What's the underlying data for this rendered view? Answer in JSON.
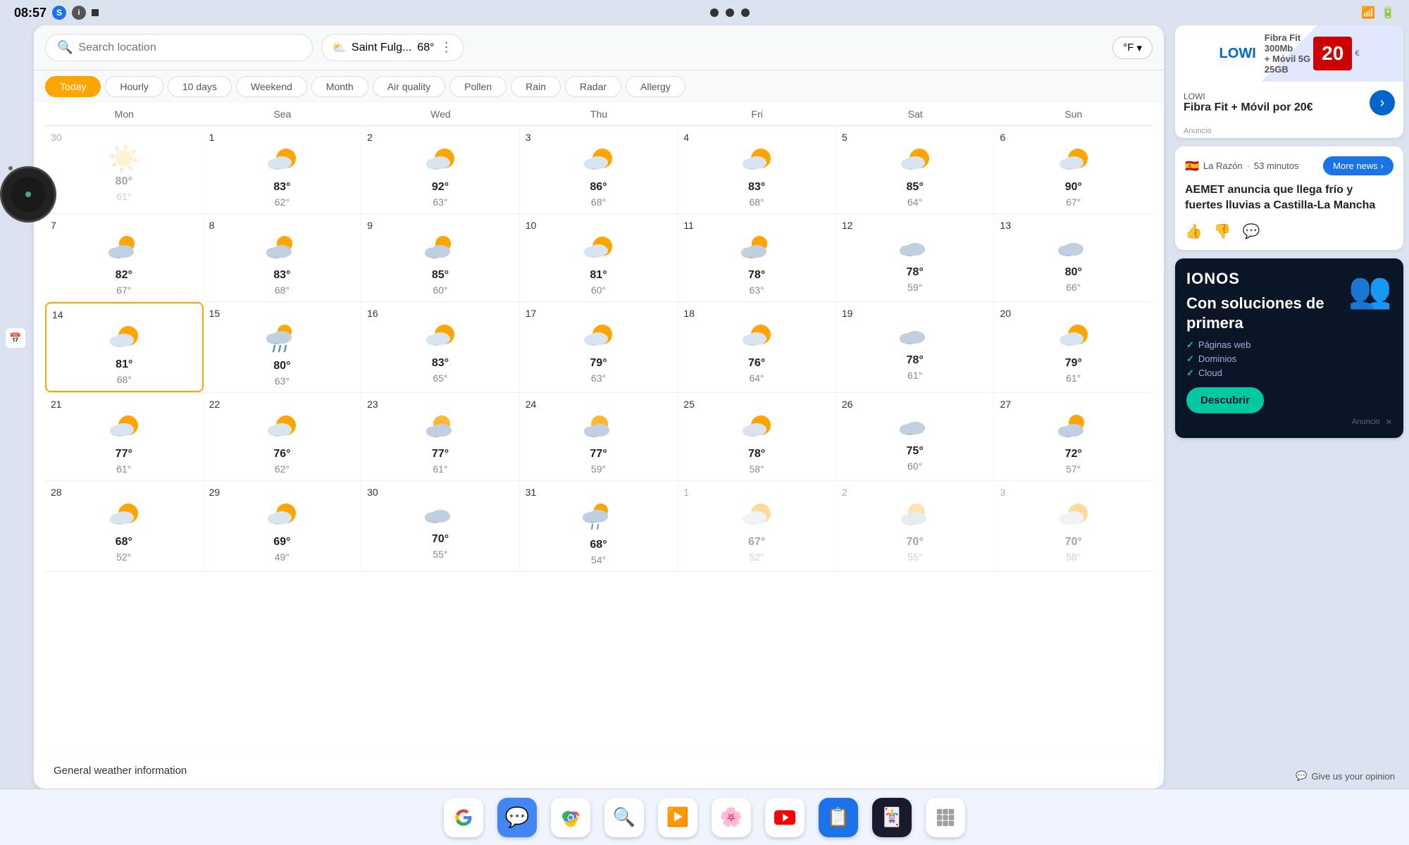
{
  "statusBar": {
    "time": "08:57",
    "icons": [
      "S",
      "info",
      "dot"
    ],
    "rightIcons": [
      "wifi",
      "battery"
    ]
  },
  "searchBar": {
    "placeholder": "Search location",
    "location": "Saint Fulg...",
    "temp": "68°",
    "unit": "°F"
  },
  "tabs": [
    {
      "label": "Today",
      "active": true
    },
    {
      "label": "Hourly"
    },
    {
      "label": "10 days"
    },
    {
      "label": "Weekend"
    },
    {
      "label": "Month"
    },
    {
      "label": "Air quality"
    },
    {
      "label": "Pollen"
    },
    {
      "label": "Rain"
    },
    {
      "label": "Radar"
    },
    {
      "label": "Allergy"
    }
  ],
  "weekDays": [
    "Mon",
    "Sea",
    "Wed",
    "Thu",
    "Fri",
    "Sat",
    "Sun"
  ],
  "calendar": {
    "weeks": [
      {
        "days": [
          {
            "num": "30",
            "icon": "sun-pale",
            "high": "80°",
            "low": "61°",
            "dimmed": true
          },
          {
            "num": "1",
            "icon": "partly-sunny",
            "high": "83°",
            "low": "62°"
          },
          {
            "num": "2",
            "icon": "partly-sunny",
            "high": "92°",
            "low": "63°"
          },
          {
            "num": "3",
            "icon": "partly-sunny",
            "high": "86°",
            "low": "68°"
          },
          {
            "num": "4",
            "icon": "partly-sunny",
            "high": "83°",
            "low": "68°"
          },
          {
            "num": "5",
            "icon": "partly-sunny",
            "high": "85°",
            "low": "64°"
          },
          {
            "num": "6",
            "icon": "partly-sunny",
            "high": "90°",
            "low": "67°"
          }
        ]
      },
      {
        "days": [
          {
            "num": "7",
            "icon": "cloudy-sun",
            "high": "82°",
            "low": "67°"
          },
          {
            "num": "8",
            "icon": "cloudy-sun",
            "high": "83°",
            "low": "68°"
          },
          {
            "num": "9",
            "icon": "cloudy-sun",
            "high": "85°",
            "low": "60°"
          },
          {
            "num": "10",
            "icon": "partly-sunny",
            "high": "81°",
            "low": "60°"
          },
          {
            "num": "11",
            "icon": "cloudy-sun",
            "high": "78°",
            "low": "63°"
          },
          {
            "num": "12",
            "icon": "cloudy",
            "high": "78°",
            "low": "59°"
          },
          {
            "num": "13",
            "icon": "cloudy",
            "high": "80°",
            "low": "66°"
          }
        ]
      },
      {
        "days": [
          {
            "num": "14",
            "icon": "partly-sunny",
            "high": "81°",
            "low": "68°",
            "highlighted": true
          },
          {
            "num": "15",
            "icon": "rainy",
            "high": "80°",
            "low": "63°"
          },
          {
            "num": "16",
            "icon": "partly-sunny",
            "high": "83°",
            "low": "65°"
          },
          {
            "num": "17",
            "icon": "partly-sunny",
            "high": "79°",
            "low": "63°"
          },
          {
            "num": "18",
            "icon": "partly-sunny",
            "high": "76°",
            "low": "64°"
          },
          {
            "num": "19",
            "icon": "cloudy",
            "high": "78°",
            "low": "61°"
          },
          {
            "num": "20",
            "icon": "partly-sunny",
            "high": "79°",
            "low": "61°"
          }
        ]
      },
      {
        "days": [
          {
            "num": "21",
            "icon": "partly-sunny",
            "high": "77°",
            "low": "61°"
          },
          {
            "num": "22",
            "icon": "partly-sunny",
            "high": "76°",
            "low": "62°"
          },
          {
            "num": "23",
            "icon": "partly-cloudy",
            "high": "77°",
            "low": "61°"
          },
          {
            "num": "24",
            "icon": "partly-cloudy",
            "high": "77°",
            "low": "59°"
          },
          {
            "num": "25",
            "icon": "partly-sunny",
            "high": "78°",
            "low": "58°"
          },
          {
            "num": "26",
            "icon": "cloudy",
            "high": "75°",
            "low": "60°"
          },
          {
            "num": "27",
            "icon": "cloudy-sun",
            "high": "72°",
            "low": "57°"
          }
        ]
      },
      {
        "days": [
          {
            "num": "28",
            "icon": "partly-sunny",
            "high": "68°",
            "low": "52°"
          },
          {
            "num": "29",
            "icon": "partly-sunny",
            "high": "69°",
            "low": "49°"
          },
          {
            "num": "30",
            "icon": "cloudy",
            "high": "70°",
            "low": "55°"
          },
          {
            "num": "31",
            "icon": "drizzle",
            "high": "68°",
            "low": "54°"
          },
          {
            "num": "1",
            "icon": "partly-sunny",
            "high": "67°",
            "low": "52°",
            "dimmed": true
          },
          {
            "num": "2",
            "icon": "partly-cloudy",
            "high": "70°",
            "low": "55°",
            "dimmed": true
          },
          {
            "num": "3",
            "icon": "partly-sunny",
            "high": "70°",
            "low": "58°",
            "dimmed": true
          }
        ]
      }
    ]
  },
  "generalInfo": {
    "label": "General weather information"
  },
  "ad1": {
    "brand": "LOWI",
    "headline": "Fibra Fit + Móvil por 20€",
    "badge": "20",
    "label": "Anuncio"
  },
  "news": {
    "source": "La Razón",
    "time": "53 minutos",
    "moreNewsLabel": "More news",
    "headline": "AEMET anuncia que llega frío y fuertes lluvias a Castilla-La Mancha"
  },
  "ad2": {
    "brand": "IONOS",
    "headline": "Con soluciones de primera",
    "checks": [
      "Páginas web",
      "Dominios",
      "Cloud"
    ],
    "cta": "Descubrir",
    "label": "Anuncio"
  },
  "opinion": {
    "label": "Give us your opinion"
  },
  "taskbar": {
    "icons": [
      {
        "name": "google",
        "emoji": "🌐",
        "color": "#fff"
      },
      {
        "name": "messages",
        "emoji": "💬",
        "color": "#4285f4"
      },
      {
        "name": "chrome",
        "emoji": "🔵",
        "color": "#fff"
      },
      {
        "name": "google-lens",
        "emoji": "🔍",
        "color": "#fff"
      },
      {
        "name": "play-store",
        "emoji": "▶️",
        "color": "#fff"
      },
      {
        "name": "photos",
        "emoji": "🌸",
        "color": "#fff"
      },
      {
        "name": "youtube",
        "emoji": "📺",
        "color": "#fff"
      },
      {
        "name": "grid-app",
        "emoji": "📱",
        "color": "#1a73e8"
      },
      {
        "name": "card-app",
        "emoji": "🃏",
        "color": "#fff"
      },
      {
        "name": "apps",
        "emoji": "⋮⋮⋮",
        "color": "#fff"
      }
    ]
  }
}
